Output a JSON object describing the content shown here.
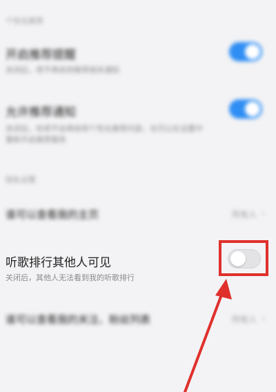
{
  "sections": [
    {
      "header": "个性化推荐"
    },
    {
      "header": "隐私设置"
    }
  ],
  "rows": [
    {
      "title": "开启推荐提醒",
      "desc": "关闭后，将不再收到推荐相关通知",
      "toggle": "on"
    },
    {
      "title": "允许推荐通知",
      "desc": "关闭后，你将不会再收到个性化推荐内容，也可以在设置中",
      "desc2": "重新开启推荐服务",
      "toggle": "on"
    },
    {
      "title": "谁可以查看我的主页",
      "value": "所有人"
    },
    {
      "title": "听歌排行其他人可见",
      "desc": "关闭后，其他人无法看到我的听歌排行",
      "toggle": "off"
    },
    {
      "title": "谁可以查看我的关注、粉丝列表",
      "value": "所有人"
    }
  ],
  "annotation": {
    "color": "#e0302c"
  }
}
